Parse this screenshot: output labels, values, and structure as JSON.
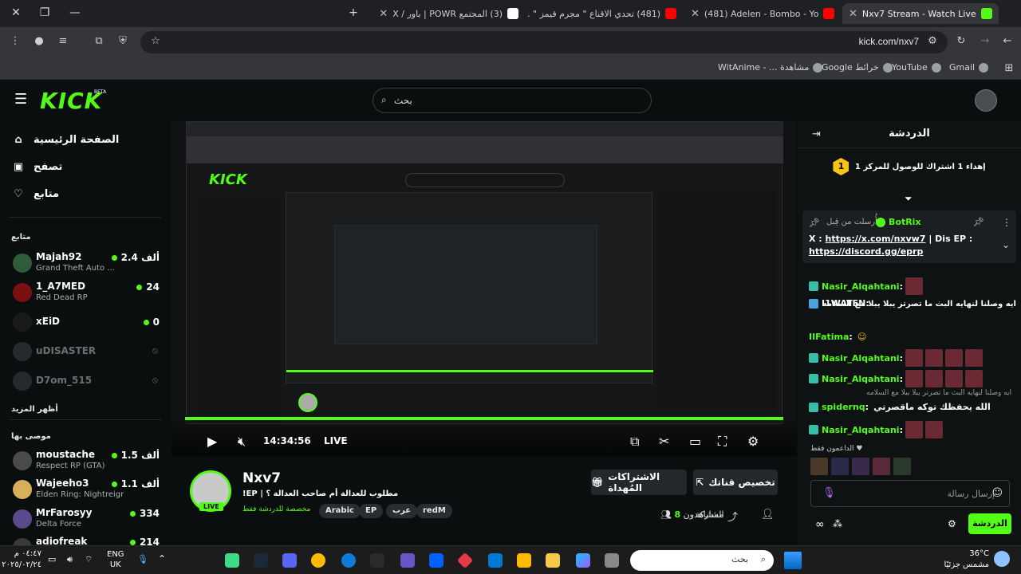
{
  "browser": {
    "tabs": [
      {
        "label": "Nxv7 Stream - Watch Live on Kick",
        "active": true,
        "favicon_color": "#53fc18"
      },
      {
        "label": "(481) Adelen - Bombo - YouTube",
        "favicon_color": "#ff0000"
      },
      {
        "label": "(481) تحدي الاقناع \" مجرم قيمز \" ..",
        "favicon_color": "#ff0000"
      },
      {
        "label": "(3) المجتمع POWR | باور / X",
        "favicon_color": "#ffffff"
      }
    ],
    "url": "kick.com/nxv7",
    "bookmarks": [
      "Gmail",
      "YouTube",
      "خرائط Google",
      "مشاهدة ... - WitAnime"
    ]
  },
  "site": {
    "logo": "KICK",
    "logo_badge": "BETA",
    "search_placeholder": "بحث"
  },
  "nav": {
    "main": [
      {
        "label": "الصفحة الرئيسية",
        "icon": "home-icon"
      },
      {
        "label": "تصفح",
        "icon": "browse-icon"
      },
      {
        "label": "متابع",
        "icon": "heart-icon"
      }
    ],
    "following_title": "متابع",
    "following": [
      {
        "name": "Majah92",
        "game": "Grand Theft Auto ...",
        "viewers": "2.4 ألف",
        "live": true
      },
      {
        "name": "1_A7MED",
        "game": "Red Dead RP",
        "viewers": "24",
        "live": true
      },
      {
        "name": "xEiD",
        "game": "",
        "viewers": "0",
        "live": true
      },
      {
        "name": "uDISASTER",
        "game": "",
        "viewers": "",
        "live": false
      },
      {
        "name": "D7om_515",
        "game": "",
        "viewers": "",
        "live": false
      }
    ],
    "show_more": "أظهر المزيد",
    "recommended_title": "موصى بها",
    "recommended": [
      {
        "name": "moustache",
        "game": "Respect RP (GTA)",
        "viewers": "1.5 ألف"
      },
      {
        "name": "Wajeeho3",
        "game": "Elden Ring: Nightreign",
        "viewers": "1.1 ألف"
      },
      {
        "name": "MrFarosyy",
        "game": "Delta Force",
        "viewers": "334"
      },
      {
        "name": "adiofreak",
        "game": "",
        "viewers": "214"
      }
    ]
  },
  "player": {
    "time": "14:34:56",
    "live_label": "LIVE",
    "progress": 1.0
  },
  "channel": {
    "name": "Nxv7",
    "live_badge": "LIVE",
    "title": "!EP | مطلوب للعدالة أم صاحب العدالة ؟",
    "subtitle": "مخصصة للدردشة فقط",
    "tags": [
      "Arabic",
      "EP",
      "عرب",
      "redM"
    ],
    "customize_label": "تخصيص قناتك",
    "gift_label": "الاشتراكات المُهداة",
    "viewers_label": "المشاهدون",
    "viewers_count": "8"
  },
  "chat": {
    "title": "الدردشة",
    "goal_badge": "1",
    "goal_text": "إهداء 1 اشتراك للوصول للمركز 1",
    "pinned": {
      "user": "BotRix",
      "sent_by": "أُرسلت من قِبل",
      "text_prefix": "X : ",
      "link1": "https://x.com/nxvw7",
      "text_mid": " | Dis EP : ",
      "link2": "https://discord.gg/eprp"
    },
    "messages": [
      {
        "user": "Nasir_Alqahtani",
        "text": ""
      },
      {
        "user": "I1WATEN",
        "text": "ايه وصلنا لنهايه البث ما تصرتر يبلا يبلا مع السلامه"
      },
      {
        "user": "IIFatima",
        "text": ""
      },
      {
        "user": "Nasir_Alqahtani",
        "text": ""
      },
      {
        "user": "Nasir_Alqahtani",
        "text": ""
      },
      {
        "user": "spidernq",
        "text": "الله يحفظك توكه ماقصرتي"
      },
      {
        "user": "Nasir_Alqahtani",
        "text": ""
      }
    ],
    "reply_preview": "ايه وصلنا لنهايه البث ما تصرتر يبلا يبلا مع السلامه",
    "supporters_label": "الداعمون فقط",
    "input_placeholder": "إرسال رسالة",
    "send_label": "الدردشة"
  },
  "taskbar": {
    "time": "٠٤:٤٧ م",
    "date": "٢٠٢٥/٠٢/٢٤",
    "lang1": "ENG",
    "lang2": "UK",
    "search_placeholder": "بحث",
    "temp": "36°C",
    "weather": "مشمس جزئيًا"
  },
  "colors": {
    "accent": "#53fc18",
    "bg": "#0b0e0f",
    "chat_bg": "#0f1213"
  }
}
